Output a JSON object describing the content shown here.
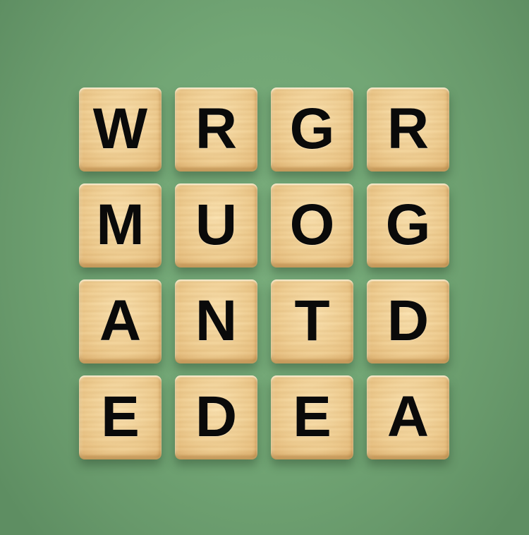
{
  "board": {
    "rows": [
      [
        "W",
        "R",
        "G",
        "R"
      ],
      [
        "M",
        "U",
        "O",
        "G"
      ],
      [
        "A",
        "N",
        "T",
        "D"
      ],
      [
        "E",
        "D",
        "E",
        "A"
      ]
    ]
  },
  "colors": {
    "background": "#72a675",
    "tile": "#f0cf94",
    "letter": "#0a0a0a"
  }
}
